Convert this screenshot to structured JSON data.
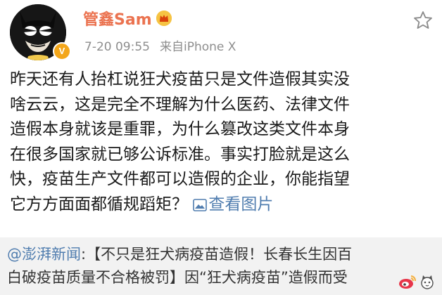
{
  "user": {
    "name": "管鑫Sam",
    "verified_badge": "V",
    "avatar_icon": "batman-mask-icon",
    "crown_icon": "crown-icon"
  },
  "meta": {
    "time": "7-20 09:55",
    "source": "来自iPhone X"
  },
  "post": {
    "lines": [
      "昨天还有人抬杠说狂犬疫苗只是文件造假其实没",
      "啥云云，这是完全不理解为什么医药、法律文件",
      "造假本身就该是重罪，为什么篡改这类文件本身",
      "在很多国家就已够公诉标准。事实打脸就是这么",
      "快，疫苗生产文件都可以造假的企业，你能指望",
      "它方方面面都循规蹈矩？"
    ],
    "view_image_label": "查看图片"
  },
  "repost": {
    "mention": "@澎湃新闻",
    "line1_rest": ":【不只是狂犬病疫苗造假！长春长生因百",
    "line2": "白破疫苗质量不合格被罚】因“狂犬病疫苗”造假而受"
  },
  "colors": {
    "username": "#eb7350",
    "link": "#507daf",
    "meta": "#8e8e8e",
    "repost_bg": "#f2f2f2",
    "badge": "#f3a61a"
  }
}
